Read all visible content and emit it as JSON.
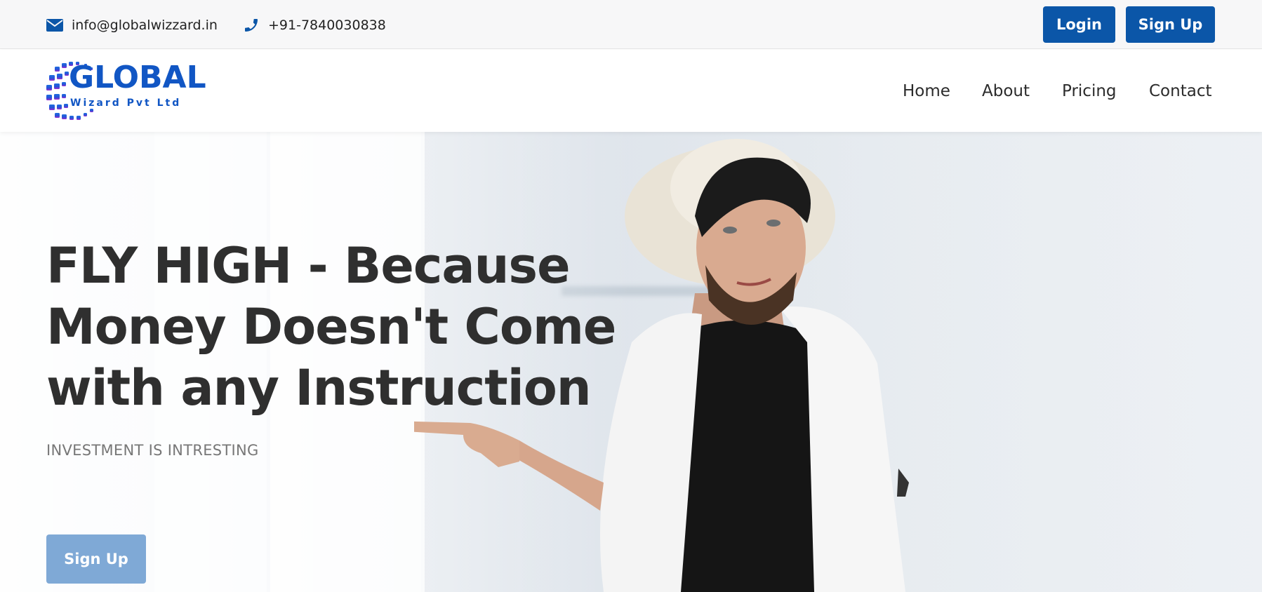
{
  "topbar": {
    "email": "info@globalwizzard.in",
    "phone": "+91-7840030838",
    "login_label": "Login",
    "signup_label": "Sign Up"
  },
  "header": {
    "logo_text": "GLOBAL",
    "logo_sub": "Wizard Pvt Ltd",
    "nav": [
      "Home",
      "About",
      "Pricing",
      "Contact"
    ]
  },
  "hero": {
    "headline_lines": [
      "FLY HIGH - Because",
      "Money Doesn't Come",
      "with any Instruction"
    ],
    "subline": "INVESTMENT IS INTRESTING",
    "button_label": "Sign Up"
  },
  "colors": {
    "primary": "#0b56a8",
    "hero_button": "#7fa9d6",
    "logo_blue": "#1156c4"
  },
  "icons": {
    "email": "envelope-icon",
    "phone": "phone-icon"
  }
}
